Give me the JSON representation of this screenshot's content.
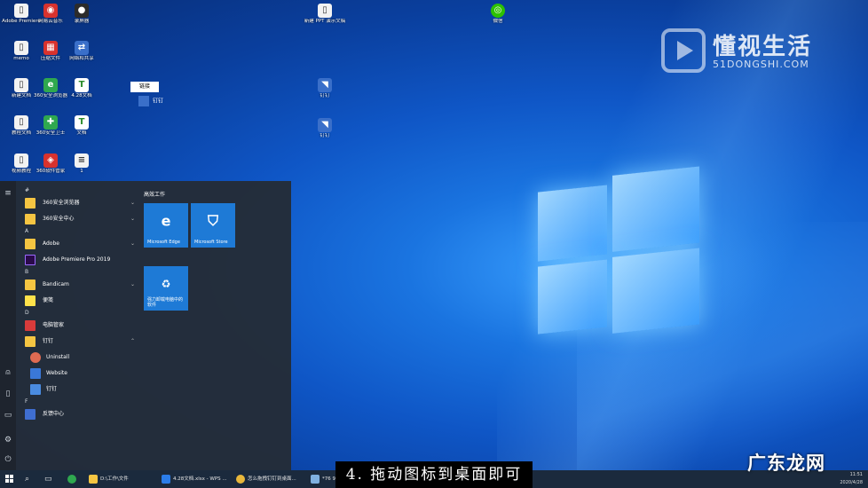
{
  "desktop": {
    "icons": [
      {
        "id": "adobe",
        "label": "Adobe Premiere",
        "glyph": "▯",
        "style": "g-file"
      },
      {
        "id": "netease",
        "label": "网易云音乐",
        "glyph": "◉",
        "style": "g-red"
      },
      {
        "id": "recorder",
        "label": "录屏器",
        "glyph": "●",
        "style": "g-dark"
      },
      {
        "id": "memo",
        "label": "memo",
        "glyph": "▯",
        "style": "g-file"
      },
      {
        "id": "winrar",
        "label": "压缩文件",
        "glyph": "▦",
        "style": "g-red"
      },
      {
        "id": "netshare",
        "label": "网络和共享",
        "glyph": "⇄",
        "style": "g-pin"
      },
      {
        "id": "doc1",
        "label": "新建文档",
        "glyph": "▯",
        "style": "g-file"
      },
      {
        "id": "browser360",
        "label": "360安全浏览器",
        "glyph": "e",
        "style": "g-green"
      },
      {
        "id": "txt1",
        "label": "4.28文档",
        "glyph": "T",
        "style": "g-doc"
      },
      {
        "id": "doc2",
        "label": "教程文档",
        "glyph": "▯",
        "style": "g-file"
      },
      {
        "id": "guard360",
        "label": "360安全卫士",
        "glyph": "✚",
        "style": "g-green"
      },
      {
        "id": "txt2",
        "label": "文档",
        "glyph": "T",
        "style": "g-doc"
      },
      {
        "id": "doc3",
        "label": "视频教程",
        "glyph": "▯",
        "style": "g-file"
      },
      {
        "id": "soft360",
        "label": "360软件管家",
        "glyph": "◈",
        "style": "g-red"
      },
      {
        "id": "ini",
        "label": "1",
        "glyph": "≡",
        "style": "g-file"
      },
      {
        "id": "ppt",
        "label": "新建 PPT 演示文稿",
        "glyph": "▯",
        "style": "g-file"
      },
      {
        "id": "wechat",
        "label": "微信",
        "glyph": "◎",
        "style": "g-chat"
      },
      {
        "id": "pin1",
        "label": "钉钉",
        "glyph": "◥",
        "style": "g-pin"
      },
      {
        "id": "pin2",
        "label": "钉钉",
        "glyph": "◥",
        "style": "g-pin"
      }
    ],
    "drag_label": "链接",
    "drag_icon_label": "钉钉"
  },
  "brand": {
    "cn": "懂视生活",
    "en": "51DONGSHI.COM"
  },
  "start_menu": {
    "tiles_title": "高效工作",
    "tiles": [
      {
        "label": "Microsoft Edge",
        "glyph": "e"
      },
      {
        "label": "Microsoft Store",
        "glyph": "⛉"
      },
      {
        "label": "强力卸载电脑中的软件",
        "glyph": "♻"
      }
    ],
    "groups": [
      {
        "letter": "#",
        "apps": [
          {
            "name": "360安全浏览器",
            "icon": "ic-folder",
            "chevron": "⌄"
          },
          {
            "name": "360安全中心",
            "icon": "ic-folder",
            "chevron": "⌄"
          }
        ]
      },
      {
        "letter": "A",
        "apps": [
          {
            "name": "Adobe",
            "icon": "ic-folder",
            "chevron": "⌄"
          },
          {
            "name": "Adobe Premiere Pro 2019",
            "icon": "ic-pr",
            "chevron": ""
          }
        ]
      },
      {
        "letter": "B",
        "apps": [
          {
            "name": "Bandicam",
            "icon": "ic-folder",
            "chevron": "⌄"
          },
          {
            "name": "便笺",
            "icon": "ic-sticky",
            "chevron": ""
          }
        ]
      },
      {
        "letter": "D",
        "apps": [
          {
            "name": "电脑管家",
            "icon": "ic-red",
            "chevron": ""
          },
          {
            "name": "钉钉",
            "icon": "ic-folder",
            "chevron": "⌃"
          }
        ]
      }
    ],
    "sub_apps": [
      {
        "name": "Uninstall",
        "icon": "ic-uninst"
      },
      {
        "name": "Website",
        "icon": "ic-web"
      },
      {
        "name": "钉钉",
        "icon": "ic-blue"
      }
    ],
    "group_f": {
      "letter": "F",
      "app": "反馈中心"
    },
    "rail_icons": [
      "≡",
      "⍝",
      "▯",
      "▭",
      "⚙",
      "⏻"
    ]
  },
  "taskbar": {
    "items": [
      {
        "label": "D:\\工作\\文件",
        "color": "#f5c542"
      },
      {
        "label": "4.28文档.xlsx - WPS ...",
        "color": "#2b7de9"
      },
      {
        "label": "怎么拖拽钉钉到桌面...",
        "color": "#e8b73b"
      },
      {
        "label": "*76 9",
        "color": "#7fb0e0"
      }
    ],
    "time": "11:51",
    "date": "2020/4/28"
  },
  "caption": "4. 拖动图标到桌面即可",
  "watermark": "广东龙网"
}
